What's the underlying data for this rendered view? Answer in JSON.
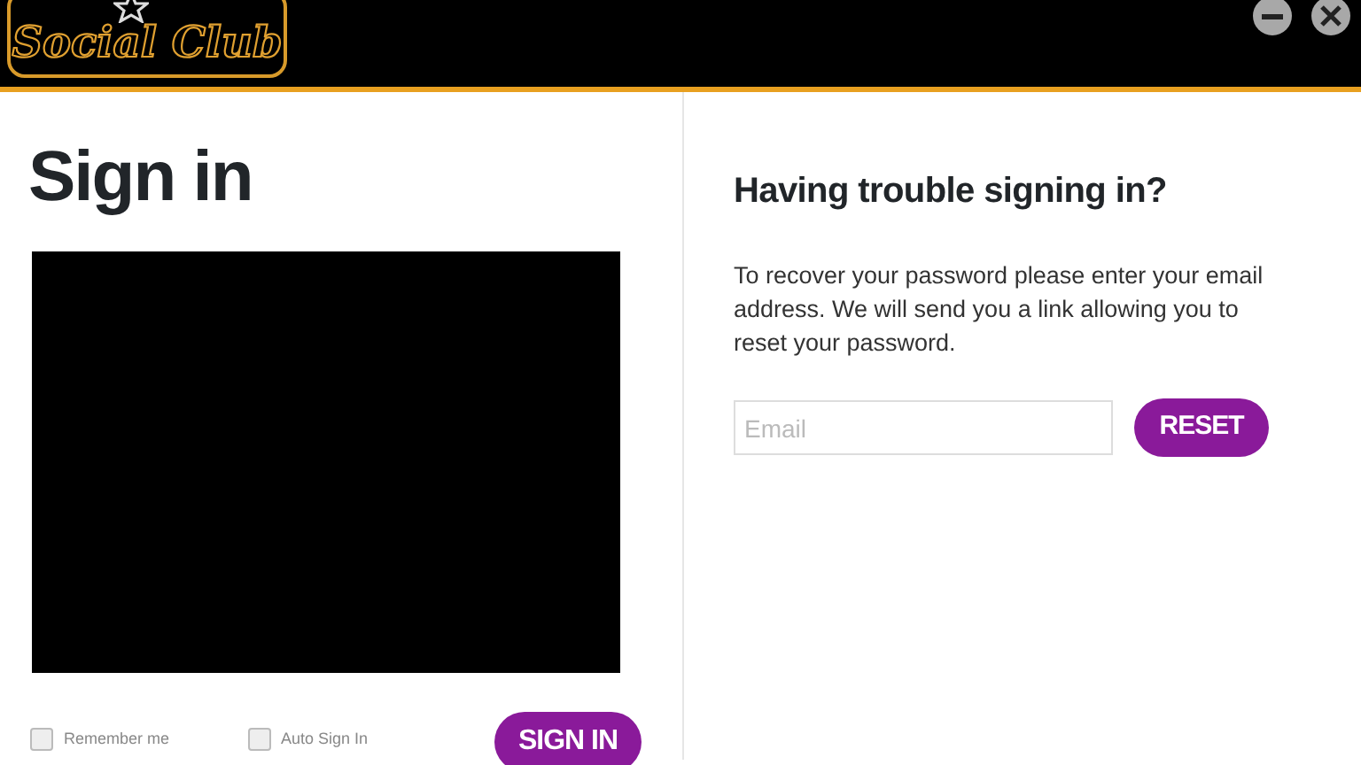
{
  "header": {
    "logo": "Social Club"
  },
  "sign_in": {
    "title": "Sign in",
    "options": [
      {
        "label": "Remember me",
        "checked": false
      },
      {
        "label": "Auto Sign In",
        "checked": false
      }
    ],
    "button": "SIGN IN"
  },
  "trouble": {
    "title": "Having trouble signing in?",
    "text": "To recover your password please enter your email address. We will send you a link allowing you to reset your password.",
    "email": {
      "placeholder": "Email"
    },
    "button": "RESET"
  }
}
